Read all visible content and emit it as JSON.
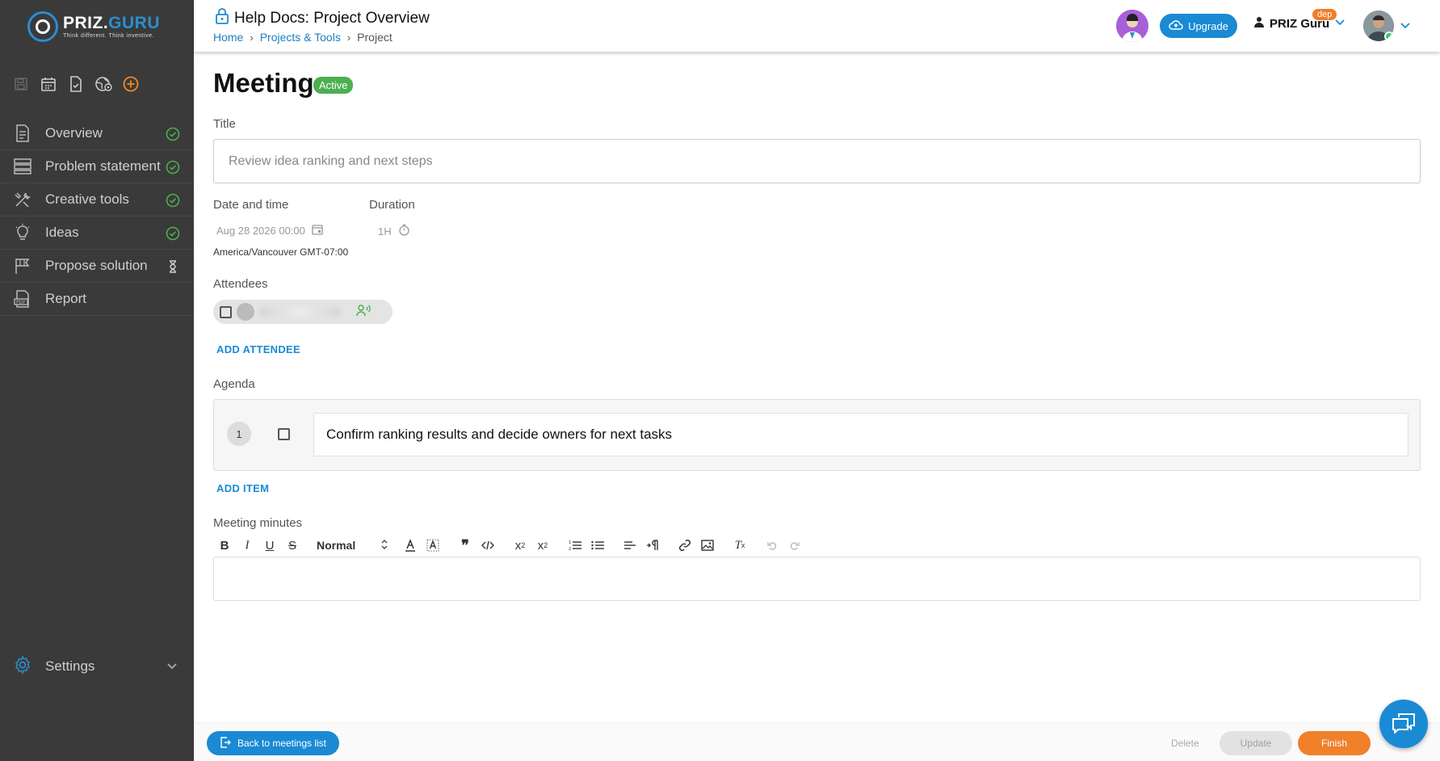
{
  "brand": {
    "name_a": "PRIZ.",
    "name_b": "GURU",
    "tagline": "Think different. Think inventive."
  },
  "sidebar": {
    "toolbar_icons": [
      "save-icon",
      "calendar-icon",
      "document-check-icon",
      "globe-settings-icon",
      "add-circle-icon"
    ],
    "items": [
      {
        "label": "Overview",
        "icon": "overview-icon",
        "status": "done"
      },
      {
        "label": "Problem statement",
        "icon": "layers-icon",
        "status": "done"
      },
      {
        "label": "Creative tools",
        "icon": "tools-icon",
        "status": "done"
      },
      {
        "label": "Ideas",
        "icon": "lightbulb-icon",
        "status": "done"
      },
      {
        "label": "Propose solution",
        "icon": "flag-icon",
        "status": "pending"
      },
      {
        "label": "Report",
        "icon": "pdf-icon",
        "status": "none"
      }
    ],
    "settings_label": "Settings"
  },
  "header": {
    "title": "Help Docs: Project Overview",
    "breadcrumb": {
      "home": "Home",
      "projects": "Projects & Tools",
      "current": "Project"
    },
    "upgrade_label": "Upgrade",
    "user_name": "PRIZ Guru",
    "env_badge": "dep"
  },
  "meeting": {
    "heading": "Meeting",
    "status": "Active",
    "title_label": "Title",
    "title_value": "Review idea ranking and next steps",
    "date_label": "Date and time",
    "date_value": "Aug 28 2026 00:00",
    "duration_label": "Duration",
    "duration_value": "1H",
    "timezone": "America/Vancouver GMT-07:00",
    "attendees_label": "Attendees",
    "add_attendee": "ADD ATTENDEE",
    "agenda_label": "Agenda",
    "agenda_items": [
      {
        "number": "1",
        "text": "Confirm ranking results and decide owners for next tasks"
      }
    ],
    "add_item": "ADD ITEM",
    "minutes_label": "Meeting minutes",
    "editor_format": "Normal"
  },
  "footer": {
    "back_label": "Back to meetings list",
    "delete_label": "Delete",
    "update_label": "Update",
    "finish_label": "Finish"
  },
  "colors": {
    "accent": "#1a8ad4",
    "sidebar_bg": "#3a3a3a",
    "active_green": "#4caf50",
    "finish_orange": "#f0802a",
    "add_orange": "#f08a24"
  }
}
